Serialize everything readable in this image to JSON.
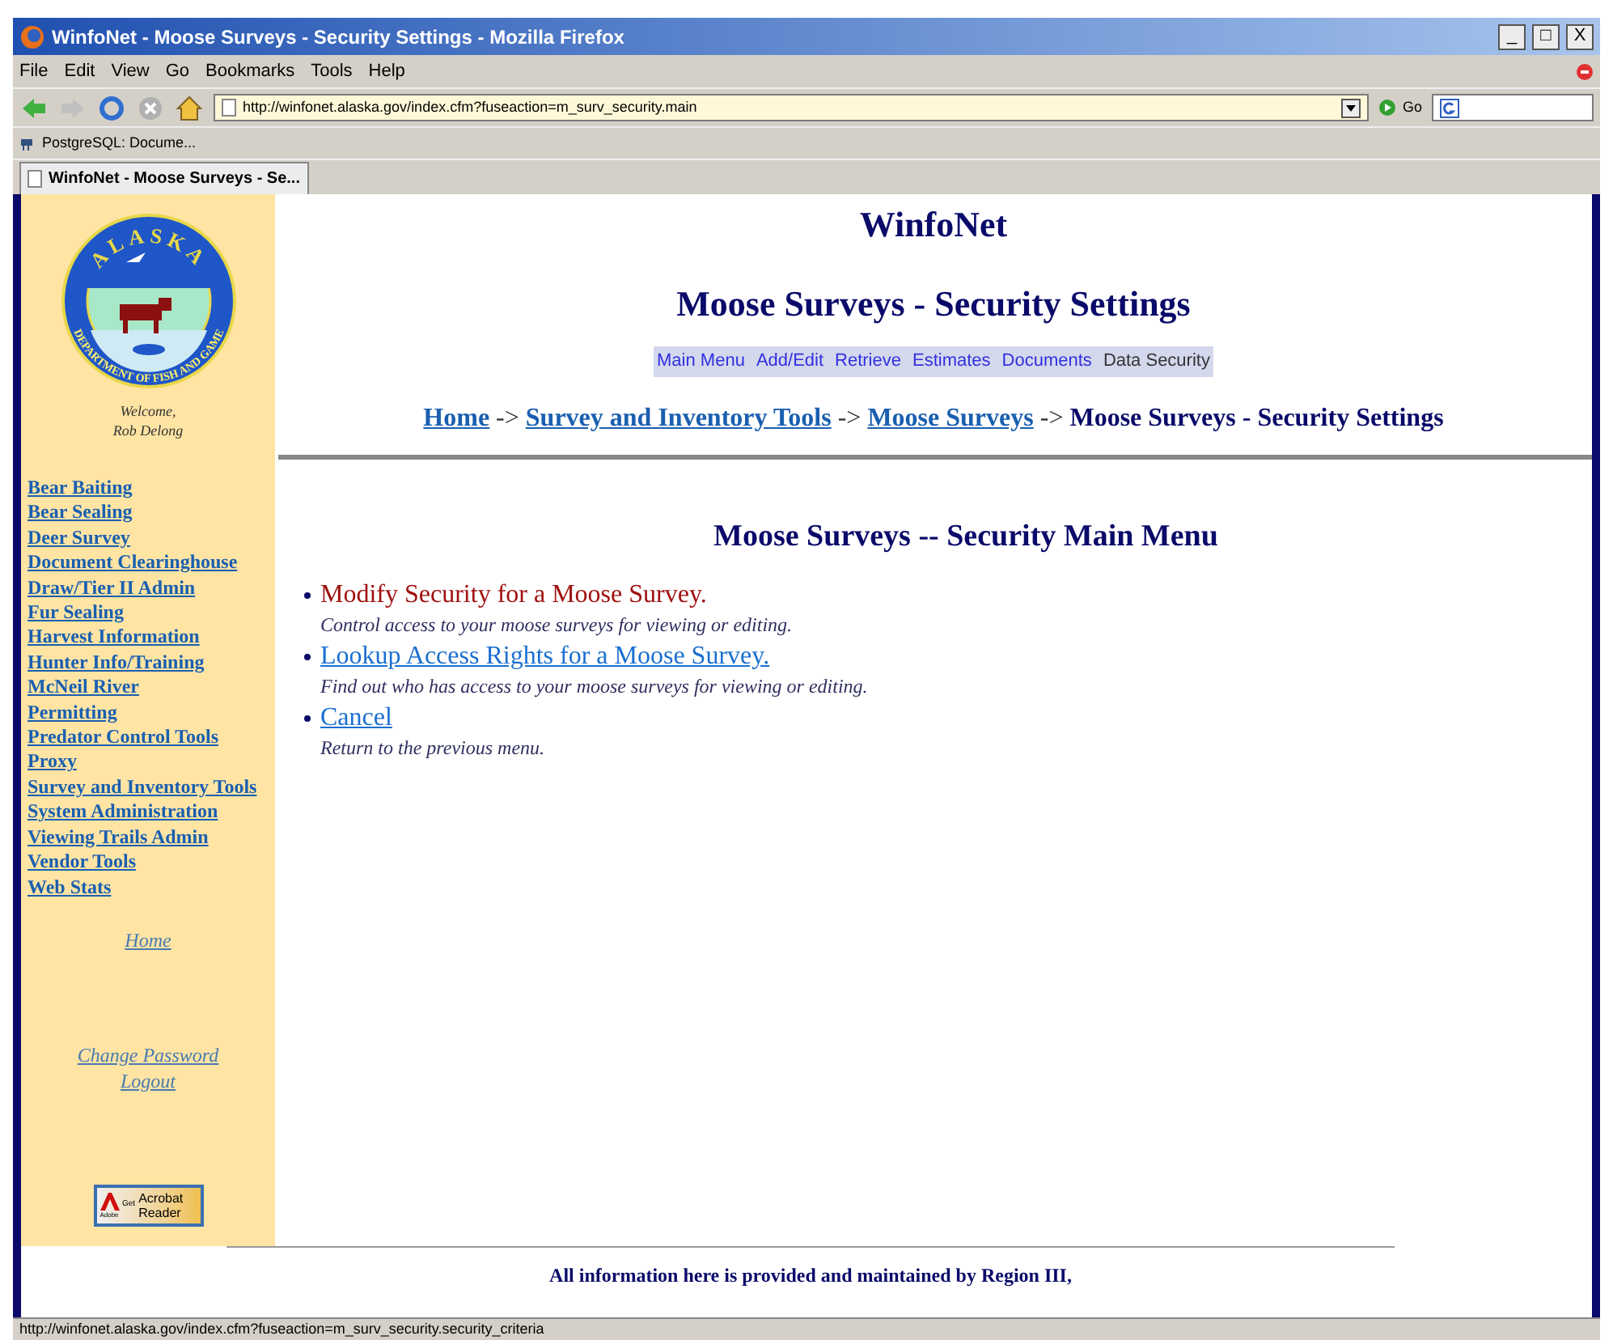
{
  "window": {
    "title": "WinfoNet - Moose Surveys - Security Settings - Mozilla Firefox",
    "controls": [
      "_",
      "□",
      "X"
    ]
  },
  "menu_bar": [
    "File",
    "Edit",
    "View",
    "Go",
    "Bookmarks",
    "Tools",
    "Help"
  ],
  "toolbar": {
    "url": "http://winfonet.alaska.gov/index.cfm?fuseaction=m_surv_security.main",
    "go_label": "Go"
  },
  "bookmarks": [
    "PostgreSQL: Docume..."
  ],
  "tabs": [
    {
      "label": "WinfoNet - Moose Surveys - Se...",
      "selected": true
    }
  ],
  "sidebar": {
    "logo": {
      "top_text": "ALASKA",
      "ring_text": "DEPARTMENT OF FISH AND GAME"
    },
    "welcome": [
      "Welcome,",
      "Rob Delong"
    ],
    "links": [
      "Bear Baiting",
      "Bear Sealing",
      "Deer Survey",
      "Document Clearinghouse",
      "Draw/Tier II Admin",
      "Fur Sealing",
      "Harvest Information",
      "Hunter Info/Training",
      "McNeil River",
      "Permitting",
      "Predator Control Tools",
      "Proxy",
      "Survey and Inventory Tools",
      "System Administration",
      "Viewing Trails Admin",
      "Vendor Tools",
      "Web Stats"
    ],
    "home_link": "Home",
    "account_links": [
      "Change Password",
      "Logout"
    ],
    "acrobat_badge": {
      "brand": "Adobe",
      "get": "Get",
      "product": [
        "Acrobat",
        "Reader"
      ]
    }
  },
  "header": {
    "site_title": "WinfoNet",
    "page_title": "Moose Surveys - Security Settings",
    "subnav": [
      {
        "label": "Main Menu",
        "selected": false
      },
      {
        "label": "Add/Edit",
        "selected": false
      },
      {
        "label": "Retrieve",
        "selected": false
      },
      {
        "label": "Estimates",
        "selected": false
      },
      {
        "label": "Documents",
        "selected": false
      },
      {
        "label": "Data Security",
        "selected": true
      }
    ],
    "breadcrumbs": [
      {
        "label": "Home",
        "kind": "link"
      },
      {
        "label": "Survey and Inventory Tools",
        "kind": "link"
      },
      {
        "label": "Moose Surveys",
        "kind": "link"
      },
      {
        "label": "Moose Surveys - Security Settings",
        "kind": "current"
      }
    ],
    "separator": "->"
  },
  "main": {
    "heading": "Moose Surveys -- Security Main Menu",
    "options": [
      {
        "label": "Modify Security for a Moose Survey.",
        "description": "Control access to your moose surveys for viewing or editing.",
        "active": true
      },
      {
        "label": "Lookup Access Rights for a Moose Survey.",
        "description": "Find out who has access to your moose surveys for viewing or editing.",
        "active": false
      },
      {
        "label": "Cancel",
        "description": "Return to the previous menu.",
        "active": false
      }
    ]
  },
  "footer": {
    "text": "All information here is provided and maintained by Region III,"
  },
  "status_bar": "http://winfonet.alaska.gov/index.cfm?fuseaction=m_surv_security.security_criteria"
}
